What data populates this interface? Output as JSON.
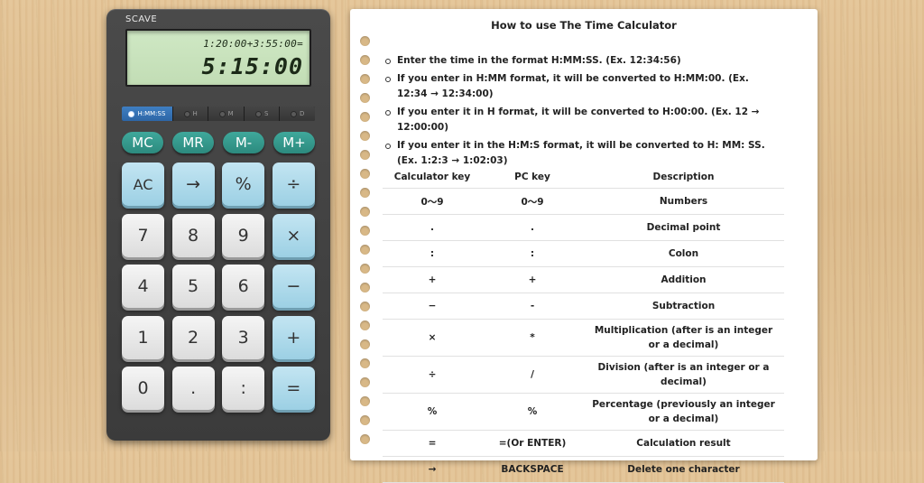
{
  "calculator": {
    "brand": "SCAVE",
    "display": {
      "expression": "1:20:00+3:55:00=",
      "result": "5:15:00"
    },
    "modes": [
      {
        "label": "H:MM:SS",
        "active": true
      },
      {
        "label": "H",
        "active": false
      },
      {
        "label": "M",
        "active": false
      },
      {
        "label": "S",
        "active": false
      },
      {
        "label": "D",
        "active": false
      }
    ],
    "memory_keys": [
      "MC",
      "MR",
      "M-",
      "M+"
    ],
    "keys": [
      {
        "label": "AC",
        "style": "blue",
        "name": "clear"
      },
      {
        "label": "→",
        "style": "blue",
        "name": "backspace"
      },
      {
        "label": "%",
        "style": "blue",
        "name": "percent"
      },
      {
        "label": "÷",
        "style": "blue",
        "name": "divide"
      },
      {
        "label": "7",
        "style": "light",
        "name": "digit-7"
      },
      {
        "label": "8",
        "style": "light",
        "name": "digit-8"
      },
      {
        "label": "9",
        "style": "light",
        "name": "digit-9"
      },
      {
        "label": "×",
        "style": "blue",
        "name": "multiply"
      },
      {
        "label": "4",
        "style": "light",
        "name": "digit-4"
      },
      {
        "label": "5",
        "style": "light",
        "name": "digit-5"
      },
      {
        "label": "6",
        "style": "light",
        "name": "digit-6"
      },
      {
        "label": "−",
        "style": "blue",
        "name": "subtract"
      },
      {
        "label": "1",
        "style": "light",
        "name": "digit-1"
      },
      {
        "label": "2",
        "style": "light",
        "name": "digit-2"
      },
      {
        "label": "3",
        "style": "light",
        "name": "digit-3"
      },
      {
        "label": "+",
        "style": "blue",
        "name": "add"
      },
      {
        "label": "0",
        "style": "light",
        "name": "digit-0"
      },
      {
        "label": ".",
        "style": "light",
        "name": "decimal"
      },
      {
        "label": ":",
        "style": "light",
        "name": "colon"
      },
      {
        "label": "=",
        "style": "blue",
        "name": "equals"
      }
    ]
  },
  "guide": {
    "title": "How to use The Time Calculator",
    "bullets": [
      "Enter the time in the format H:MM:SS. (Ex. 12:34:56)",
      "If you enter in H:MM format, it will be converted to H:MM:00. (Ex. 12:34 → 12:34:00)",
      "If you enter it in H format, it will be converted to H:00:00. (Ex. 12 → 12:00:00)",
      "If you enter it in the H:M:S format, it will be converted to H: MM: SS. (Ex. 1:2:3 → 1:02:03)"
    ],
    "table": {
      "headers": [
        "Calculator key",
        "PC key",
        "Description"
      ],
      "rows": [
        {
          "calc": "0～9",
          "pc": "0～9",
          "desc": "Numbers"
        },
        {
          "calc": ".",
          "pc": ".",
          "desc": "Decimal point"
        },
        {
          "calc": ":",
          "pc": ":",
          "desc": "Colon"
        },
        {
          "calc": "+",
          "pc": "+",
          "desc": "Addition"
        },
        {
          "calc": "−",
          "pc": "-",
          "desc": "Subtraction"
        },
        {
          "calc": "×",
          "pc": "*",
          "desc": "Multiplication (after is an integer or a decimal)"
        },
        {
          "calc": "÷",
          "pc": "/",
          "desc": "Division (after is an integer or a decimal)"
        },
        {
          "calc": "%",
          "pc": "%",
          "desc": "Percentage (previously an integer or a decimal)"
        },
        {
          "calc": "=",
          "pc": "=(Or ENTER)",
          "desc": "Calculation result"
        },
        {
          "calc": "→",
          "pc": "BACKSPACE",
          "desc": "Delete one character"
        }
      ]
    }
  },
  "colors": {
    "display_bg": "#c6e0b9",
    "memory_key": "#2f8f82",
    "operator_key": "#a7d7ea",
    "active_mode": "#3576b8"
  }
}
